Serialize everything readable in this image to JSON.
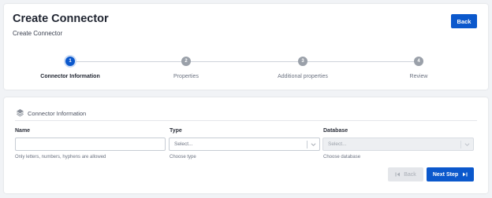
{
  "header": {
    "title": "Create Connector",
    "subtitle": "Create Connector",
    "back_label": "Back"
  },
  "stepper": {
    "steps": [
      {
        "number": "1",
        "label": "Connector Information",
        "active": true
      },
      {
        "number": "2",
        "label": "Properties",
        "active": false
      },
      {
        "number": "3",
        "label": "Additional properties",
        "active": false
      },
      {
        "number": "4",
        "label": "Review",
        "active": false
      }
    ]
  },
  "form": {
    "section_title": "Connector Information",
    "name": {
      "label": "Name",
      "value": "",
      "help": "Only letters, numbers, hyphens are allowed"
    },
    "type": {
      "label": "Type",
      "placeholder": "Select...",
      "help": "Choose type"
    },
    "database": {
      "label": "Database",
      "placeholder": "Select...",
      "help": "Choose database"
    },
    "prev_label": "Back",
    "next_label": "Next Step"
  },
  "colors": {
    "primary": "#0b58cc",
    "background": "#f1f3f6"
  },
  "icons": [
    "layers-icon",
    "chevron-down-icon",
    "skip-back-icon",
    "skip-forward-icon"
  ]
}
